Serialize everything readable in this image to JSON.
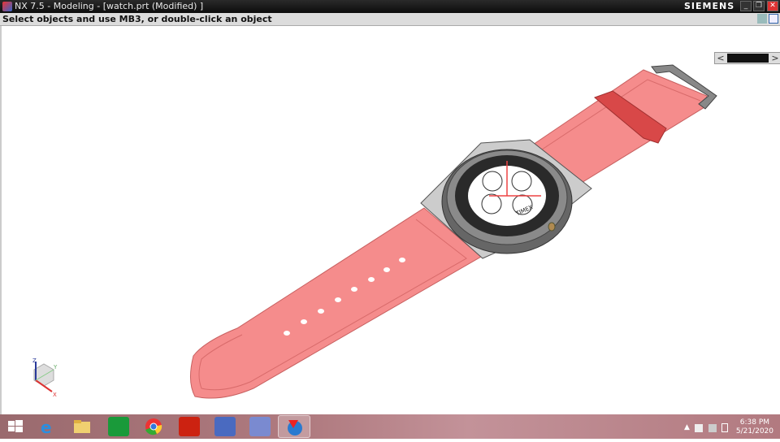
{
  "window": {
    "title": "NX 7.5 - Modeling - [watch.prt (Modified) ]",
    "brand": "SIEMENS",
    "min": "_",
    "max": "❐",
    "close": "✕"
  },
  "status": {
    "prompt": "Select objects and use MB3, or double-click an object"
  },
  "scroller": {
    "left": "<",
    "right": ">"
  },
  "triad": {
    "x": "X",
    "y": "Y",
    "z": "Z"
  },
  "watch": {
    "dial_brand": "TIMEX"
  },
  "taskbar": {
    "apps": [
      "start",
      "internet-explorer",
      "file-explorer",
      "store",
      "chrome",
      "acrobat",
      "media-app",
      "utility-app",
      "nx"
    ],
    "time": "6:38 PM",
    "date": "5/21/2020",
    "tray_arrow": "▲"
  },
  "colors": {
    "strap": "#f58c8c",
    "strap_edge": "#d86a6a",
    "case": "#555",
    "accent": "#d33"
  }
}
